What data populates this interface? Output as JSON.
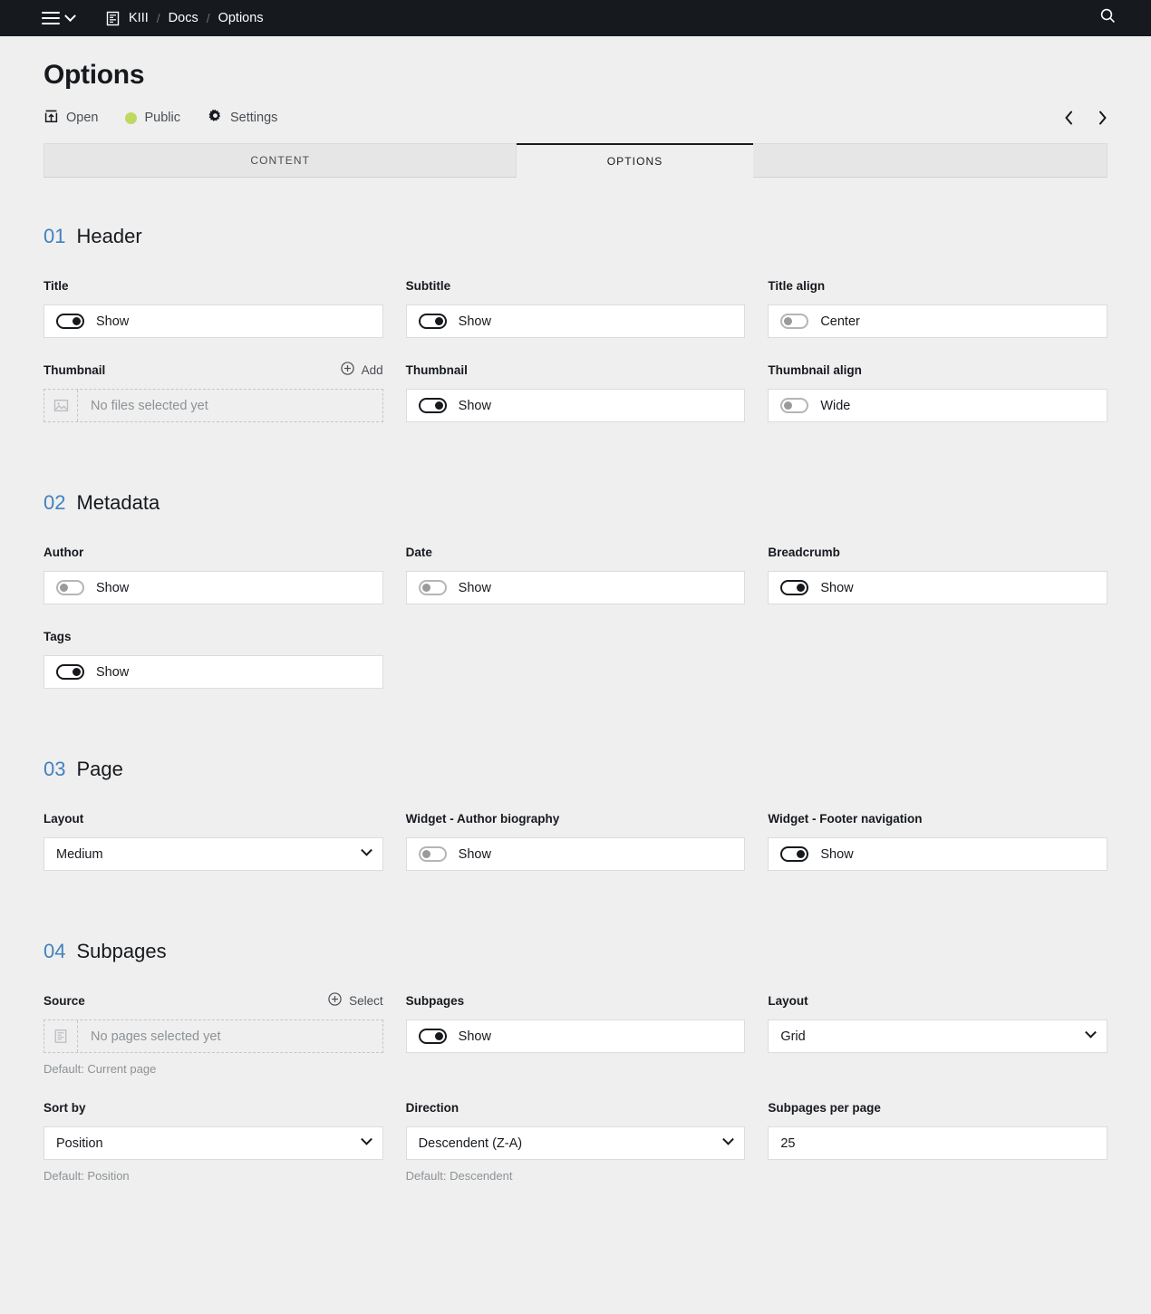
{
  "topbar": {
    "menu_icon": "hamburger-icon",
    "menu_chevron_icon": "chevron-down-icon",
    "site_icon": "page-icon",
    "breadcrumb": [
      {
        "label": "KIII"
      },
      {
        "label": "Docs"
      },
      {
        "label": "Options"
      }
    ],
    "separator": "/",
    "search_icon": "search-icon"
  },
  "header": {
    "title": "Options",
    "meta": [
      {
        "label": "Open",
        "icon": "open-external-icon"
      },
      {
        "label": "Public",
        "icon": "status-dot",
        "color": "#bed95f"
      },
      {
        "label": "Settings",
        "icon": "gear-icon"
      }
    ],
    "pager": {
      "prev_icon": "chevron-left-icon",
      "next_icon": "chevron-right-icon"
    }
  },
  "tabs": [
    {
      "label": "CONTENT",
      "active": false
    },
    {
      "label": "OPTIONS",
      "active": true
    }
  ],
  "sections": [
    {
      "num": "01",
      "name": "Header",
      "fields": [
        {
          "label": "Title",
          "type": "toggle",
          "state": "on",
          "value": "Show"
        },
        {
          "label": "Subtitle",
          "type": "toggle",
          "state": "on",
          "value": "Show"
        },
        {
          "label": "Title align",
          "type": "toggle",
          "state": "off",
          "value": "Center"
        },
        {
          "label": "Thumbnail",
          "type": "empty",
          "value": "No files selected yet",
          "icon": "image-icon",
          "action": "Add",
          "action_icon": "plus-circle-icon"
        },
        {
          "label": "Thumbnail",
          "type": "toggle",
          "state": "on",
          "value": "Show"
        },
        {
          "label": "Thumbnail align",
          "type": "toggle",
          "state": "off",
          "value": "Wide"
        }
      ]
    },
    {
      "num": "02",
      "name": "Metadata",
      "fields": [
        {
          "label": "Author",
          "type": "toggle",
          "state": "off",
          "value": "Show"
        },
        {
          "label": "Date",
          "type": "toggle",
          "state": "off",
          "value": "Show"
        },
        {
          "label": "Breadcrumb",
          "type": "toggle",
          "state": "on",
          "value": "Show"
        },
        {
          "label": "Tags",
          "type": "toggle",
          "state": "on",
          "value": "Show"
        }
      ]
    },
    {
      "num": "03",
      "name": "Page",
      "fields": [
        {
          "label": "Layout",
          "type": "select",
          "value": "Medium"
        },
        {
          "label": "Widget - Author biography",
          "type": "toggle",
          "state": "off",
          "value": "Show"
        },
        {
          "label": "Widget - Footer navigation",
          "type": "toggle",
          "state": "on",
          "value": "Show"
        }
      ]
    },
    {
      "num": "04",
      "name": "Subpages",
      "fields": [
        {
          "label": "Source",
          "type": "empty",
          "value": "No pages selected yet",
          "icon": "pages-icon",
          "action": "Select",
          "action_icon": "plus-circle-icon",
          "help": "Default: Current page"
        },
        {
          "label": "Subpages",
          "type": "toggle",
          "state": "on",
          "value": "Show"
        },
        {
          "label": "Layout",
          "type": "select",
          "value": "Grid"
        },
        {
          "label": "Sort by",
          "type": "select",
          "value": "Position",
          "help": "Default: Position"
        },
        {
          "label": "Direction",
          "type": "select",
          "value": "Descendent (Z-A)",
          "help": "Default: Descendent"
        },
        {
          "label": "Subpages per page",
          "type": "text",
          "value": "25"
        }
      ]
    }
  ],
  "colors": {
    "accent": "#4182be",
    "topbar_bg": "#16191e",
    "page_bg": "#efefef",
    "public_dot": "#bed95f"
  }
}
